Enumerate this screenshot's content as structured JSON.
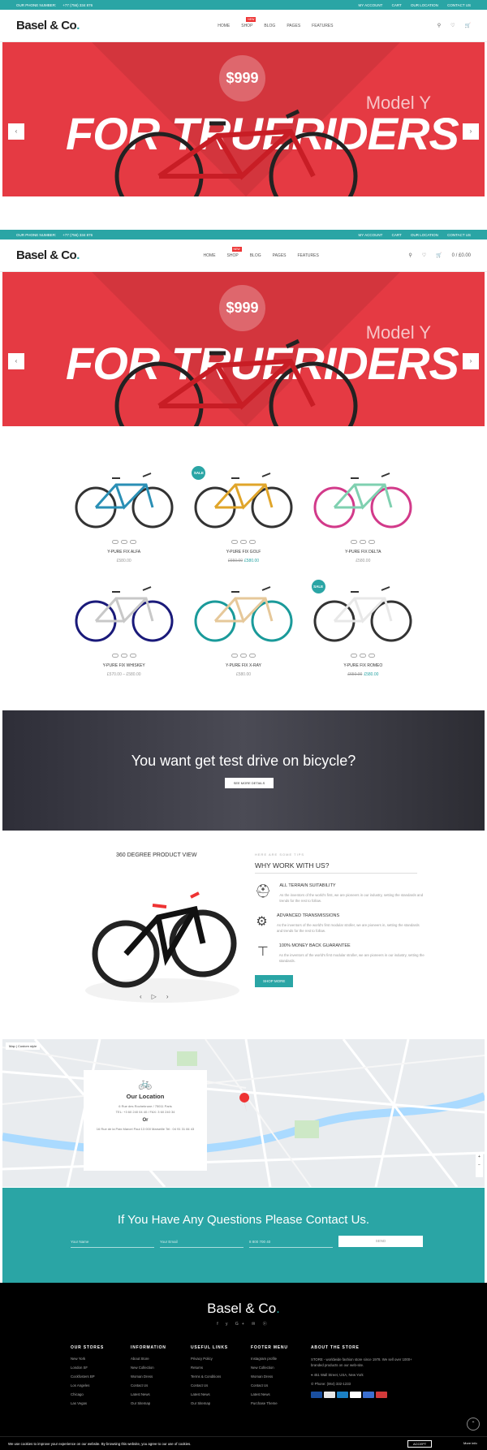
{
  "topbar": {
    "phone_label": "OUR PHONE NUMBER:",
    "phone": "+77 (756) 334 876",
    "links": [
      "MY ACCOUNT",
      "CART",
      "OUR LOCATION",
      "CONTACT US"
    ]
  },
  "header": {
    "logo_text": "Basel & Co",
    "logo_dot": ".",
    "nav": [
      "HOME",
      "SHOP",
      "BLOG",
      "PAGES",
      "FEATURES"
    ],
    "new_badge": "NEW",
    "cart_total": "0 / £0.00",
    "wishlist_count": "0",
    "cart_count": "0"
  },
  "hero": {
    "price": "$999",
    "model": "Model Y",
    "headline": "FOR TRUERIDERS",
    "prev_icon": "chevron-left",
    "next_icon": "chevron-right"
  },
  "products": [
    {
      "name": "Y-PURE FIX ALFA",
      "price": "£580.00",
      "old": "",
      "sale": false,
      "frame": "#2a8fb5",
      "rim": "#333"
    },
    {
      "name": "Y-PURE FIX GOLF",
      "price": "£580.00",
      "old": "£650.00",
      "sale": true,
      "frame": "#e0a52a",
      "rim": "#333"
    },
    {
      "name": "Y-PURE FIX DELTA",
      "price": "£580.00",
      "old": "",
      "sale": false,
      "frame": "#7fd0b0",
      "rim": "#d23a8a"
    },
    {
      "name": "Y-PURE FIX WHISKEY",
      "price": "£570.00 – £580.00",
      "old": "",
      "sale": false,
      "frame": "#c8c8c8",
      "rim": "#1a1a7a"
    },
    {
      "name": "Y-PURE FIX X-RAY",
      "price": "£580.00",
      "old": "",
      "sale": false,
      "frame": "#e6c89a",
      "rim": "#1a9a9a"
    },
    {
      "name": "Y-PURE FIX ROMEO",
      "price": "£580.00",
      "old": "£650.00",
      "sale": true,
      "frame": "#e8e8e8",
      "rim": "#333"
    }
  ],
  "sale_label": "SALE",
  "banner": {
    "title": "You want get test drive on bicycle?",
    "button": "SEE MORE DETAILS"
  },
  "view360": {
    "title": "360 DEGREE PRODUCT VIEW"
  },
  "why": {
    "kicker": "HERE ARE SOME TIPS",
    "title": "WHY WORK WITH US?",
    "features": [
      {
        "icon": "helmet-icon",
        "title": "ALL TERRAIN SUITABILITY",
        "desc": "As the inventors of the world's first, we are pioneers in our industry, setting the standards and trends for the rest to follow."
      },
      {
        "icon": "brake-disc-icon",
        "title": "ADVANCED TRANSMISSIONS",
        "desc": "As the inventors of the world's first modular stroller, we are pioneers in, setting the standards and trends for the rest to follow."
      },
      {
        "icon": "pump-icon",
        "title": "100% MONEY BACK GUARANTEE",
        "desc": "As the inventors of the world's first modular stroller, we are pioneers in our industry, setting the standards."
      }
    ],
    "button": "SHOP MORE"
  },
  "map": {
    "type_buttons": [
      "Map",
      "Custom style"
    ],
    "location_title": "Our Location",
    "address1": "6 Rue des Rochebrune / 75011 Paris",
    "phone1": "TEL: +3 60 240 04 40 / FAX: 3 60 240 34",
    "or": "Or",
    "address2": "16 Rue de la Paix Marcel Paul 13 000 Marseille Tel : 04 91 31 84 43"
  },
  "contact": {
    "title": "If You Have Any Questions Please Contact Us.",
    "name_placeholder": "Your Name",
    "email_placeholder": "Your Email",
    "phone_placeholder": "8 800 700 40",
    "send": "SEND"
  },
  "footer": {
    "logo_text": "Basel & Co",
    "logo_dot": ".",
    "social": "f  y  G+  ✉  ⓟ",
    "columns": [
      {
        "title": "OUR STORES",
        "items": [
          "New York",
          "London SF",
          "Cockfosters BP",
          "Los Angeles",
          "Chicago",
          "Las Vegas"
        ]
      },
      {
        "title": "INFORMATION",
        "items": [
          "About Store",
          "New Collection",
          "Woman Dress",
          "Contact Us",
          "Latest News",
          "Our Sitemap"
        ]
      },
      {
        "title": "USEFUL LINKS",
        "items": [
          "Privacy Policy",
          "Returns",
          "Terms & Conditions",
          "Contact Us",
          "Latest News",
          "Our Sitemap"
        ]
      },
      {
        "title": "FOOTER MENU",
        "items": [
          "Instagram profile",
          "New Collection",
          "Woman Dress",
          "Contact Us",
          "Latest News",
          "Purchase Theme"
        ]
      }
    ],
    "about_title": "ABOUT THE STORE",
    "about_text": "STORE - worldwide fashion store since 1978. We sell over 1000+ branded products on our web-site.",
    "address": "451 Wall Street, USA, New York",
    "phone": "Phone: (064) 332-1233"
  },
  "cookie": {
    "text": "We use cookies to improve your experience on our website. By browsing this website, you agree to our use of cookies.",
    "accept": "ACCEPT",
    "more": "More info"
  },
  "colors": {
    "accent": "#2aa5a5",
    "hero": "#e53a43",
    "sale": "#e33333"
  }
}
